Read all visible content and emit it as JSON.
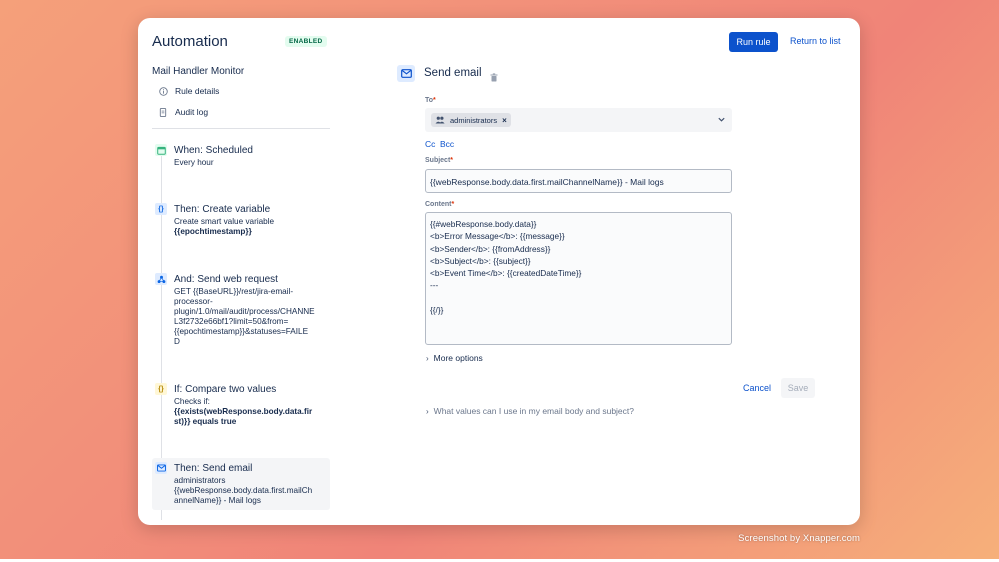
{
  "header": {
    "title": "Automation",
    "status_badge": "ENABLED",
    "run_rule_label": "Run rule",
    "return_label": "Return to list"
  },
  "sidebar": {
    "rule_name": "Mail Handler Monitor",
    "nav_items": [
      {
        "label": "Rule details",
        "icon": "info-icon"
      },
      {
        "label": "Audit log",
        "icon": "document-icon"
      }
    ],
    "steps": [
      {
        "title": "When: Scheduled",
        "desc": "Every hour",
        "icon": "calendar-icon",
        "icon_color": "#36b37e"
      },
      {
        "title": "Then: Create variable",
        "desc": "Create smart value variable",
        "desc_bold": "{{epochtimestamp}}",
        "icon": "braces-icon",
        "icon_color": "#0c66e4"
      },
      {
        "title": "And: Send web request",
        "desc_lines": [
          "GET {{BaseURL}}/rest/jira-email-",
          "processor-",
          "plugin/1.0/mail/audit/process/CHANNE",
          "L3f2732e66bf1?limit=50&from=",
          "{{epochtimestamp}}&statuses=FAILE",
          "D"
        ],
        "icon": "webhook-icon",
        "icon_color": "#0c66e4"
      },
      {
        "title": "If: Compare two values",
        "desc": "Checks if:",
        "desc_bold_lines": [
          "{{exists(webResponse.body.data.fir",
          "st)}} equals true"
        ],
        "icon": "braces-icon",
        "icon_color": "#ffab00"
      },
      {
        "title": "Then: Send email",
        "desc_lines": [
          "administrators",
          "{{webResponse.body.data.first.mailCh",
          "annelName}} - Mail logs"
        ],
        "icon": "envelope-icon",
        "icon_color": "#0c66e4"
      }
    ]
  },
  "panel": {
    "title": "Send email",
    "to_label": "To",
    "to_chip": "administrators",
    "cc_label": "Cc",
    "bcc_label": "Bcc",
    "subject_label": "Subject",
    "subject_value": "{{webResponse.body.data.first.mailChannelName}} - Mail logs",
    "content_label": "Content",
    "content_lines": [
      "{{#webResponse.body.data}}",
      "<b>Error Message</b>: {{message}}",
      "<b>Sender</b>: {{fromAddress}}",
      "<b>Subject</b>: {{subject}}",
      "<b>Event Time</b>: {{createdDateTime}}",
      "---",
      "",
      "{{/}}"
    ],
    "more_options_label": "More options",
    "cancel_label": "Cancel",
    "save_label": "Save",
    "help_label": "What values can I use in my email body and subject?"
  },
  "watermark": "Screenshot by Xnapper.com",
  "colors": {
    "primary": "#0c52cc",
    "badge_bg": "#e3fcef",
    "badge_text": "#006644"
  }
}
